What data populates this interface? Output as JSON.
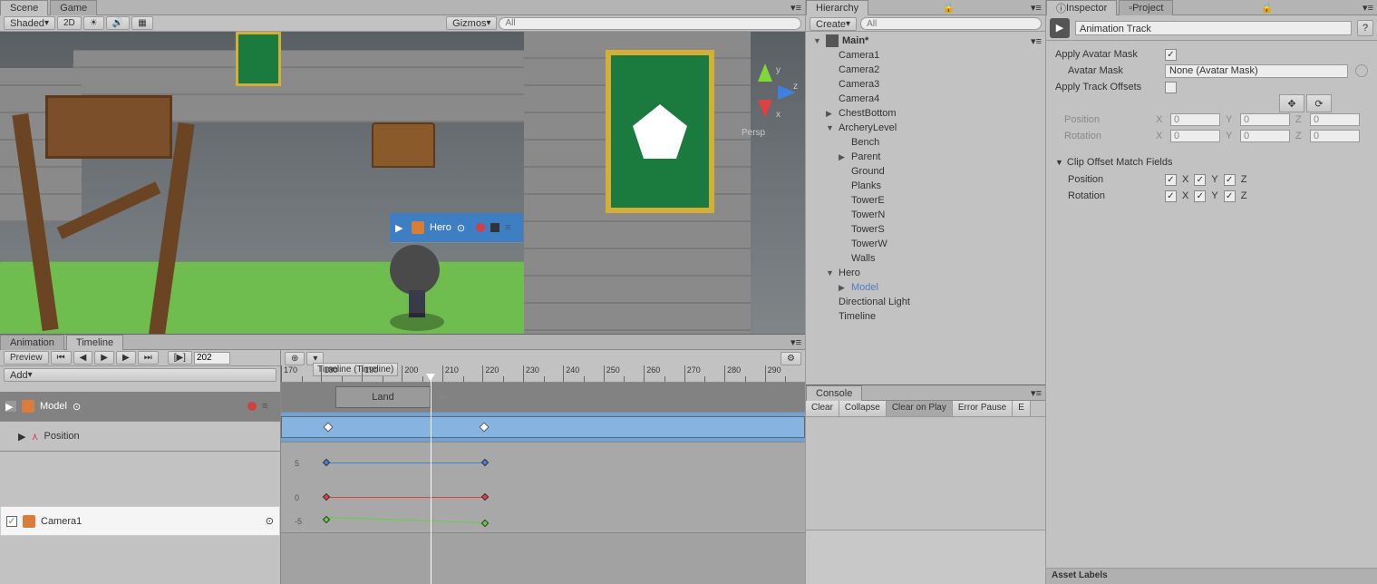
{
  "scene": {
    "tab_scene": "Scene",
    "tab_game": "Game",
    "shade_mode": "Shaded",
    "btn_2d": "2D",
    "gizmos": "Gizmos",
    "search_placeholder": "All",
    "persp": "Persp",
    "axis_x": "x",
    "axis_y": "y",
    "axis_z": "z"
  },
  "timeline": {
    "tab_animation": "Animation",
    "tab_timeline": "Timeline",
    "preview": "Preview",
    "frame": "202",
    "add": "Add",
    "header_label": "Timeline (Timeline)",
    "ticks": [
      "170",
      "180",
      "190",
      "200",
      "210",
      "220",
      "230",
      "240",
      "250",
      "260",
      "270",
      "280",
      "290"
    ],
    "tracks": {
      "model": "Model",
      "hero": "Hero",
      "position": "Position",
      "camera": "Camera1"
    },
    "clip_land": "Land",
    "axis_5": "5",
    "axis_0": "0",
    "axis_n5": "-5"
  },
  "hierarchy": {
    "tab": "Hierarchy",
    "create": "Create",
    "search_placeholder": "All",
    "scene_name": "Main*",
    "items": [
      {
        "label": "Camera1",
        "indent": 1
      },
      {
        "label": "Camera2",
        "indent": 1
      },
      {
        "label": "Camera3",
        "indent": 1
      },
      {
        "label": "Camera4",
        "indent": 1
      },
      {
        "label": "ChestBottom",
        "indent": 1,
        "arrow": "▶"
      },
      {
        "label": "ArcheryLevel",
        "indent": 1,
        "arrow": "▼"
      },
      {
        "label": "Bench",
        "indent": 2
      },
      {
        "label": "Parent",
        "indent": 2,
        "arrow": "▶"
      },
      {
        "label": "Ground",
        "indent": 2
      },
      {
        "label": "Planks",
        "indent": 2
      },
      {
        "label": "TowerE",
        "indent": 2
      },
      {
        "label": "TowerN",
        "indent": 2
      },
      {
        "label": "TowerS",
        "indent": 2
      },
      {
        "label": "TowerW",
        "indent": 2
      },
      {
        "label": "Walls",
        "indent": 2
      },
      {
        "label": "Hero",
        "indent": 1,
        "arrow": "▼"
      },
      {
        "label": "Model",
        "indent": 2,
        "arrow": "▶",
        "selected": true
      },
      {
        "label": "Directional Light",
        "indent": 1
      },
      {
        "label": "Timeline",
        "indent": 1
      }
    ]
  },
  "console": {
    "tab": "Console",
    "clear": "Clear",
    "collapse": "Collapse",
    "clear_on_play": "Clear on Play",
    "error_pause": "Error Pause",
    "editor": "E"
  },
  "inspector": {
    "tab_inspector": "Inspector",
    "tab_project": "Project",
    "title": "Animation Track",
    "apply_avatar_mask": "Apply Avatar Mask",
    "avatar_mask": "Avatar Mask",
    "avatar_mask_value": "None (Avatar Mask)",
    "apply_track_offsets": "Apply Track Offsets",
    "position": "Position",
    "rotation": "Rotation",
    "axis_x": "X",
    "axis_y": "Y",
    "axis_z": "Z",
    "val_0": "0",
    "clip_offset": "Clip Offset Match Fields",
    "asset_labels": "Asset Labels"
  }
}
